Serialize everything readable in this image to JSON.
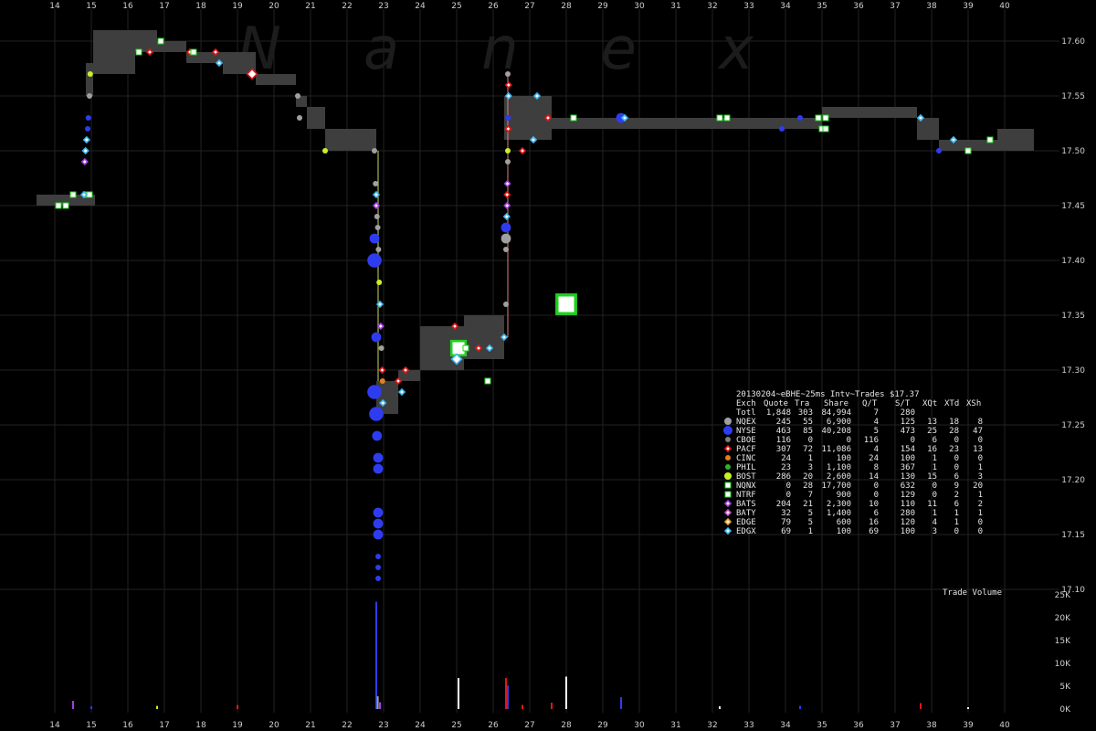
{
  "chart_data": [
    {
      "type": "scatter",
      "watermark": "Nanex",
      "x_ticks": [
        "14",
        "15",
        "16",
        "17",
        "18",
        "19",
        "20",
        "21",
        "22",
        "23",
        "24",
        "25",
        "26",
        "27",
        "28",
        "29",
        "30",
        "31",
        "32",
        "33",
        "34",
        "35",
        "36",
        "37",
        "38",
        "39",
        "40"
      ],
      "y_ticks": [
        "17.60",
        "17.55",
        "17.50",
        "17.45",
        "17.40",
        "17.35",
        "17.30",
        "17.25",
        "17.20",
        "17.15",
        "17.10"
      ],
      "xlim": [
        13.5,
        40.5
      ],
      "ylim": [
        17.1,
        17.62
      ],
      "quote_bands": [
        {
          "x0": 13.5,
          "x1": 14.7,
          "lo": 17.45,
          "hi": 17.46
        },
        {
          "x0": 14.7,
          "x1": 15.1,
          "lo": 17.45,
          "hi": 17.46
        },
        {
          "x0": 14.85,
          "x1": 15.05,
          "lo": 17.55,
          "hi": 17.58
        },
        {
          "x0": 15.05,
          "x1": 15.2,
          "lo": 17.57,
          "hi": 17.61
        },
        {
          "x0": 15.2,
          "x1": 16.8,
          "lo": 17.59,
          "hi": 17.61
        },
        {
          "x0": 15.2,
          "x1": 16.2,
          "lo": 17.57,
          "hi": 17.59
        },
        {
          "x0": 16.8,
          "x1": 17.6,
          "lo": 17.59,
          "hi": 17.6
        },
        {
          "x0": 17.6,
          "x1": 18.6,
          "lo": 17.58,
          "hi": 17.59
        },
        {
          "x0": 18.6,
          "x1": 19.5,
          "lo": 17.57,
          "hi": 17.59
        },
        {
          "x0": 19.5,
          "x1": 20.6,
          "lo": 17.56,
          "hi": 17.57
        },
        {
          "x0": 20.6,
          "x1": 20.9,
          "lo": 17.54,
          "hi": 17.55
        },
        {
          "x0": 20.9,
          "x1": 21.4,
          "lo": 17.52,
          "hi": 17.54
        },
        {
          "x0": 21.4,
          "x1": 22.8,
          "lo": 17.5,
          "hi": 17.52
        },
        {
          "x0": 22.8,
          "x1": 23.4,
          "lo": 17.26,
          "hi": 17.29
        },
        {
          "x0": 23.4,
          "x1": 24.0,
          "lo": 17.29,
          "hi": 17.3
        },
        {
          "x0": 24.0,
          "x1": 25.2,
          "lo": 17.3,
          "hi": 17.34
        },
        {
          "x0": 25.2,
          "x1": 26.3,
          "lo": 17.31,
          "hi": 17.35
        },
        {
          "x0": 26.3,
          "x1": 27.6,
          "lo": 17.51,
          "hi": 17.55
        },
        {
          "x0": 27.6,
          "x1": 35.0,
          "lo": 17.52,
          "hi": 17.53
        },
        {
          "x0": 35.0,
          "x1": 37.6,
          "lo": 17.53,
          "hi": 17.54
        },
        {
          "x0": 37.6,
          "x1": 38.2,
          "lo": 17.51,
          "hi": 17.53
        },
        {
          "x0": 38.2,
          "x1": 39.0,
          "lo": 17.5,
          "hi": 17.51
        },
        {
          "x0": 39.0,
          "x1": 39.8,
          "lo": 17.5,
          "hi": 17.51
        },
        {
          "x0": 39.8,
          "x1": 40.8,
          "lo": 17.5,
          "hi": 17.52
        }
      ],
      "trades": [
        {
          "x": 14.1,
          "y": 17.45,
          "ex": "NTRF",
          "s": 1
        },
        {
          "x": 14.3,
          "y": 17.45,
          "ex": "NTRF",
          "s": 1
        },
        {
          "x": 14.5,
          "y": 17.46,
          "ex": "NTRF",
          "s": 1
        },
        {
          "x": 14.85,
          "y": 17.46,
          "ex": "NTRF",
          "s": 1
        },
        {
          "x": 14.95,
          "y": 17.46,
          "ex": "NTRF",
          "s": 1
        },
        {
          "x": 14.8,
          "y": 17.46,
          "ex": "EDGX",
          "s": 1
        },
        {
          "x": 14.82,
          "y": 17.49,
          "ex": "BATS",
          "s": 1
        },
        {
          "x": 14.84,
          "y": 17.5,
          "ex": "EDGX",
          "s": 1
        },
        {
          "x": 14.87,
          "y": 17.51,
          "ex": "EDGX",
          "s": 1
        },
        {
          "x": 14.9,
          "y": 17.52,
          "ex": "NYSE",
          "s": 1
        },
        {
          "x": 14.92,
          "y": 17.53,
          "ex": "NYSE",
          "s": 1
        },
        {
          "x": 14.95,
          "y": 17.55,
          "ex": "NQEX",
          "s": 1
        },
        {
          "x": 14.97,
          "y": 17.57,
          "ex": "BOST",
          "s": 1
        },
        {
          "x": 16.3,
          "y": 17.59,
          "ex": "NTRF",
          "s": 1
        },
        {
          "x": 16.6,
          "y": 17.59,
          "ex": "PACF",
          "s": 1
        },
        {
          "x": 16.9,
          "y": 17.6,
          "ex": "NTRF",
          "s": 1
        },
        {
          "x": 17.7,
          "y": 17.59,
          "ex": "PACF",
          "s": 1
        },
        {
          "x": 17.8,
          "y": 17.59,
          "ex": "NTRF",
          "s": 1
        },
        {
          "x": 18.4,
          "y": 17.59,
          "ex": "PACF",
          "s": 1
        },
        {
          "x": 18.5,
          "y": 17.58,
          "ex": "EDGX",
          "s": 1
        },
        {
          "x": 19.4,
          "y": 17.57,
          "ex": "PACF",
          "s": 2
        },
        {
          "x": 20.65,
          "y": 17.55,
          "ex": "NQEX",
          "s": 1
        },
        {
          "x": 20.7,
          "y": 17.53,
          "ex": "NQEX",
          "s": 1
        },
        {
          "x": 21.4,
          "y": 17.5,
          "ex": "BOST",
          "s": 1
        },
        {
          "x": 22.75,
          "y": 17.5,
          "ex": "NQEX",
          "s": 1
        },
        {
          "x": 22.78,
          "y": 17.47,
          "ex": "NQEX",
          "s": 1
        },
        {
          "x": 22.8,
          "y": 17.46,
          "ex": "EDGX",
          "s": 1
        },
        {
          "x": 22.8,
          "y": 17.45,
          "ex": "BATS",
          "s": 1
        },
        {
          "x": 22.82,
          "y": 17.44,
          "ex": "NQEX",
          "s": 1
        },
        {
          "x": 22.84,
          "y": 17.43,
          "ex": "NQEX",
          "s": 1
        },
        {
          "x": 22.75,
          "y": 17.42,
          "ex": "NYSE",
          "s": 2
        },
        {
          "x": 22.86,
          "y": 17.41,
          "ex": "NQEX",
          "s": 1
        },
        {
          "x": 22.75,
          "y": 17.4,
          "ex": "NYSE",
          "s": 3
        },
        {
          "x": 22.88,
          "y": 17.38,
          "ex": "BOST",
          "s": 1
        },
        {
          "x": 22.9,
          "y": 17.36,
          "ex": "EDGX",
          "s": 1
        },
        {
          "x": 22.92,
          "y": 17.34,
          "ex": "BATS",
          "s": 1
        },
        {
          "x": 22.8,
          "y": 17.33,
          "ex": "NYSE",
          "s": 2
        },
        {
          "x": 22.94,
          "y": 17.32,
          "ex": "NQEX",
          "s": 1
        },
        {
          "x": 22.96,
          "y": 17.3,
          "ex": "PACF",
          "s": 1
        },
        {
          "x": 22.97,
          "y": 17.29,
          "ex": "CINC",
          "s": 1
        },
        {
          "x": 22.75,
          "y": 17.28,
          "ex": "NYSE",
          "s": 3
        },
        {
          "x": 22.98,
          "y": 17.27,
          "ex": "EDGX",
          "s": 1
        },
        {
          "x": 22.8,
          "y": 17.26,
          "ex": "NYSE",
          "s": 3
        },
        {
          "x": 22.82,
          "y": 17.24,
          "ex": "NYSE",
          "s": 2
        },
        {
          "x": 22.85,
          "y": 17.22,
          "ex": "NYSE",
          "s": 2
        },
        {
          "x": 22.85,
          "y": 17.21,
          "ex": "NYSE",
          "s": 2
        },
        {
          "x": 22.85,
          "y": 17.17,
          "ex": "NYSE",
          "s": 2
        },
        {
          "x": 22.85,
          "y": 17.16,
          "ex": "NYSE",
          "s": 2
        },
        {
          "x": 22.85,
          "y": 17.15,
          "ex": "NYSE",
          "s": 2
        },
        {
          "x": 22.85,
          "y": 17.13,
          "ex": "NYSE",
          "s": 1
        },
        {
          "x": 22.85,
          "y": 17.12,
          "ex": "NYSE",
          "s": 1
        },
        {
          "x": 22.85,
          "y": 17.11,
          "ex": "NYSE",
          "s": 1
        },
        {
          "x": 23.4,
          "y": 17.29,
          "ex": "PACF",
          "s": 1
        },
        {
          "x": 23.6,
          "y": 17.3,
          "ex": "PACF",
          "s": 1
        },
        {
          "x": 23.5,
          "y": 17.28,
          "ex": "EDGX",
          "s": 1
        },
        {
          "x": 24.95,
          "y": 17.34,
          "ex": "PACF",
          "s": 1
        },
        {
          "x": 25.05,
          "y": 17.32,
          "ex": "NTRF",
          "s": 3
        },
        {
          "x": 25.0,
          "y": 17.31,
          "ex": "EDGX",
          "s": 2
        },
        {
          "x": 25.25,
          "y": 17.32,
          "ex": "NTRF",
          "s": 1
        },
        {
          "x": 25.6,
          "y": 17.32,
          "ex": "PACF",
          "s": 1
        },
        {
          "x": 25.9,
          "y": 17.32,
          "ex": "EDGX",
          "s": 1
        },
        {
          "x": 25.85,
          "y": 17.29,
          "ex": "NTRF",
          "s": 1
        },
        {
          "x": 26.3,
          "y": 17.33,
          "ex": "EDGX",
          "s": 1
        },
        {
          "x": 26.35,
          "y": 17.36,
          "ex": "NQEX",
          "s": 1
        },
        {
          "x": 26.35,
          "y": 17.41,
          "ex": "NQEX",
          "s": 1
        },
        {
          "x": 26.35,
          "y": 17.42,
          "ex": "NQEX",
          "s": 2
        },
        {
          "x": 26.35,
          "y": 17.43,
          "ex": "NYSE",
          "s": 2
        },
        {
          "x": 26.37,
          "y": 17.44,
          "ex": "EDGX",
          "s": 1
        },
        {
          "x": 26.38,
          "y": 17.45,
          "ex": "BATS",
          "s": 1
        },
        {
          "x": 26.38,
          "y": 17.46,
          "ex": "PACF",
          "s": 1
        },
        {
          "x": 26.39,
          "y": 17.47,
          "ex": "BATS",
          "s": 1
        },
        {
          "x": 26.4,
          "y": 17.49,
          "ex": "NQEX",
          "s": 1
        },
        {
          "x": 26.4,
          "y": 17.5,
          "ex": "BOST",
          "s": 1
        },
        {
          "x": 26.41,
          "y": 17.52,
          "ex": "PACF",
          "s": 1
        },
        {
          "x": 26.41,
          "y": 17.53,
          "ex": "NYSE",
          "s": 1
        },
        {
          "x": 26.42,
          "y": 17.55,
          "ex": "EDGX",
          "s": 1
        },
        {
          "x": 26.42,
          "y": 17.56,
          "ex": "PACF",
          "s": 1
        },
        {
          "x": 26.4,
          "y": 17.57,
          "ex": "NQEX",
          "s": 1
        },
        {
          "x": 26.8,
          "y": 17.5,
          "ex": "PACF",
          "s": 1
        },
        {
          "x": 27.1,
          "y": 17.51,
          "ex": "EDGX",
          "s": 1
        },
        {
          "x": 27.2,
          "y": 17.55,
          "ex": "EDGX",
          "s": 1
        },
        {
          "x": 27.5,
          "y": 17.53,
          "ex": "PACF",
          "s": 1
        },
        {
          "x": 28.2,
          "y": 17.53,
          "ex": "NTRF",
          "s": 1
        },
        {
          "x": 28.0,
          "y": 17.36,
          "ex": "NTRF",
          "s": 4
        },
        {
          "x": 29.5,
          "y": 17.53,
          "ex": "NYSE",
          "s": 2
        },
        {
          "x": 29.6,
          "y": 17.53,
          "ex": "EDGX",
          "s": 1
        },
        {
          "x": 32.2,
          "y": 17.53,
          "ex": "NTRF",
          "s": 1
        },
        {
          "x": 32.4,
          "y": 17.53,
          "ex": "NTRF",
          "s": 1
        },
        {
          "x": 33.9,
          "y": 17.52,
          "ex": "NYSE",
          "s": 1
        },
        {
          "x": 34.4,
          "y": 17.53,
          "ex": "NYSE",
          "s": 1
        },
        {
          "x": 34.9,
          "y": 17.53,
          "ex": "NTRF",
          "s": 1
        },
        {
          "x": 35.1,
          "y": 17.53,
          "ex": "NTRF",
          "s": 1
        },
        {
          "x": 35.0,
          "y": 17.52,
          "ex": "NTRF",
          "s": 1
        },
        {
          "x": 35.1,
          "y": 17.52,
          "ex": "NTRF",
          "s": 1
        },
        {
          "x": 37.7,
          "y": 17.53,
          "ex": "EDGX",
          "s": 1
        },
        {
          "x": 38.2,
          "y": 17.5,
          "ex": "NYSE",
          "s": 1
        },
        {
          "x": 38.6,
          "y": 17.51,
          "ex": "EDGX",
          "s": 1
        },
        {
          "x": 39.0,
          "y": 17.5,
          "ex": "NTRF",
          "s": 1
        },
        {
          "x": 39.6,
          "y": 17.51,
          "ex": "NTRF",
          "s": 1
        }
      ]
    },
    {
      "type": "bar",
      "title": "Trade Volume",
      "y_ticks": [
        "25K",
        "20K",
        "15K",
        "10K",
        "5K",
        "0K"
      ],
      "ylim": [
        0,
        25000
      ],
      "bars": [
        {
          "x": 14.5,
          "v": 1800,
          "ex": "BATS"
        },
        {
          "x": 15.0,
          "v": 600,
          "ex": "NYSE"
        },
        {
          "x": 16.8,
          "v": 700,
          "ex": "BOST"
        },
        {
          "x": 19.0,
          "v": 900,
          "ex": "PACF"
        },
        {
          "x": 22.8,
          "v": 23500,
          "ex": "NYSE"
        },
        {
          "x": 22.84,
          "v": 2800,
          "ex": "NQEX"
        },
        {
          "x": 22.9,
          "v": 1500,
          "ex": "BATS"
        },
        {
          "x": 25.05,
          "v": 6800,
          "ex": "NTRF"
        },
        {
          "x": 26.35,
          "v": 6800,
          "ex": "PACF"
        },
        {
          "x": 26.4,
          "v": 5200,
          "ex": "NYSE"
        },
        {
          "x": 26.8,
          "v": 900,
          "ex": "PACF"
        },
        {
          "x": 28.0,
          "v": 7100,
          "ex": "NTRF"
        },
        {
          "x": 27.6,
          "v": 1400,
          "ex": "PACF"
        },
        {
          "x": 29.5,
          "v": 2600,
          "ex": "NYSE"
        },
        {
          "x": 32.2,
          "v": 600,
          "ex": "NTRF"
        },
        {
          "x": 34.4,
          "v": 700,
          "ex": "NYSE"
        },
        {
          "x": 37.7,
          "v": 1300,
          "ex": "PACF"
        },
        {
          "x": 39.0,
          "v": 400,
          "ex": "NTRF"
        }
      ]
    }
  ],
  "table": {
    "title": "20130204~eBHE~25ms Intv~Trades $17.37",
    "header": [
      "Exch",
      "Quote",
      "Tra",
      "Share",
      "Q/T",
      "S/T",
      "XQt",
      "XTd",
      "XSh"
    ],
    "total": [
      "Totl",
      "1,848",
      "303",
      "84,994",
      "7",
      "280",
      "",
      "",
      ""
    ],
    "rows": [
      {
        "ex": "NQEX",
        "cells": [
          "NQEX",
          "245",
          "55",
          "6,900",
          "4",
          "125",
          "13",
          "18",
          "8"
        ]
      },
      {
        "ex": "NYSE",
        "cells": [
          "NYSE",
          "463",
          "85",
          "40,208",
          "5",
          "473",
          "25",
          "28",
          "47"
        ]
      },
      {
        "ex": "CBOE",
        "cells": [
          "CBOE",
          "116",
          "0",
          "0",
          "116",
          "0",
          "6",
          "0",
          "0"
        ]
      },
      {
        "ex": "PACF",
        "cells": [
          "PACF",
          "307",
          "72",
          "11,086",
          "4",
          "154",
          "16",
          "23",
          "13"
        ]
      },
      {
        "ex": "CINC",
        "cells": [
          "CINC",
          "24",
          "1",
          "100",
          "24",
          "100",
          "1",
          "0",
          "0"
        ]
      },
      {
        "ex": "PHIL",
        "cells": [
          "PHIL",
          "23",
          "3",
          "1,100",
          "8",
          "367",
          "1",
          "0",
          "1"
        ]
      },
      {
        "ex": "BOST",
        "cells": [
          "BOST",
          "286",
          "20",
          "2,600",
          "14",
          "130",
          "15",
          "6",
          "3"
        ]
      },
      {
        "ex": "NQNX",
        "cells": [
          "NQNX",
          "0",
          "28",
          "17,700",
          "0",
          "632",
          "0",
          "9",
          "20"
        ]
      },
      {
        "ex": "NTRF",
        "cells": [
          "NTRF",
          "0",
          "7",
          "900",
          "0",
          "129",
          "0",
          "2",
          "1"
        ]
      },
      {
        "ex": "BATS",
        "cells": [
          "BATS",
          "204",
          "21",
          "2,300",
          "10",
          "110",
          "11",
          "6",
          "2"
        ]
      },
      {
        "ex": "BATY",
        "cells": [
          "BATY",
          "32",
          "5",
          "1,400",
          "6",
          "280",
          "1",
          "1",
          "1"
        ]
      },
      {
        "ex": "EDGE",
        "cells": [
          "EDGE",
          "79",
          "5",
          "600",
          "16",
          "120",
          "4",
          "1",
          "0"
        ]
      },
      {
        "ex": "EDGX",
        "cells": [
          "EDGX",
          "69",
          "1",
          "100",
          "69",
          "100",
          "3",
          "0",
          "0"
        ]
      }
    ]
  },
  "colors": {
    "background": "#000000",
    "band": "#3e3e3e",
    "grid": "#222222",
    "watermark": "#1c1c1c",
    "NQEX": "#a0a0a0",
    "NYSE": "#2e3cf0",
    "CBOE": "#7d7d7d",
    "PACF": "#e01818",
    "CINC": "#e08020",
    "PHIL": "#30b030",
    "BOST": "#c8f028",
    "NQNX": "#20e020",
    "NTRF": "#ffffff",
    "BATS": "#a040e0",
    "BATY": "#c050c0",
    "EDGE": "#e0a030",
    "EDGX": "#40b8f0"
  },
  "marker_shapes": {
    "NQEX": "circle",
    "NYSE": "circle",
    "CBOE": "circle",
    "PACF": "diamond",
    "CINC": "circle",
    "PHIL": "circle",
    "BOST": "circle",
    "NQNX": "square",
    "NTRF": "square",
    "BATS": "diamond",
    "BATY": "diamond",
    "EDGE": "diamond",
    "EDGX": "diamond"
  }
}
